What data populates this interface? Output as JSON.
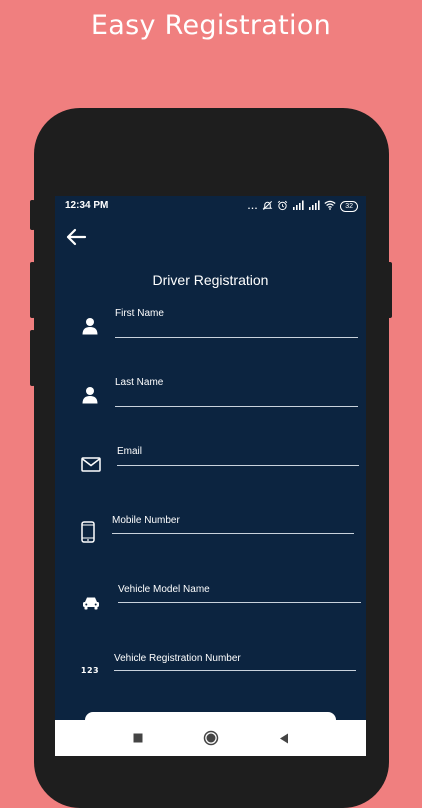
{
  "banner": {
    "title": "Easy Registration"
  },
  "status_bar": {
    "time": "12:34 PM",
    "dots": "...",
    "battery": "32"
  },
  "header": {
    "title": "Driver Registration"
  },
  "form": {
    "fields": [
      {
        "label": "First Name",
        "icon": "person-icon",
        "value": ""
      },
      {
        "label": "Last Name",
        "icon": "person-icon",
        "value": ""
      },
      {
        "label": "Email",
        "icon": "envelope-icon",
        "value": ""
      },
      {
        "label": "Mobile Number",
        "icon": "mobile-phone-icon",
        "value": ""
      },
      {
        "label": "Vehicle Model Name",
        "icon": "car-icon",
        "value": ""
      },
      {
        "label": "Vehicle Registration Number",
        "icon": "number-123-icon",
        "value": ""
      }
    ],
    "number_icon_text": "123"
  },
  "nav_bar": {
    "items": [
      "recent-apps-button",
      "home-button",
      "back-nav-button"
    ]
  },
  "colors": {
    "background": "#F07F7F",
    "phone_frame": "#1E1E1E",
    "screen": "#0C2440",
    "text": "#FFFFFF"
  }
}
